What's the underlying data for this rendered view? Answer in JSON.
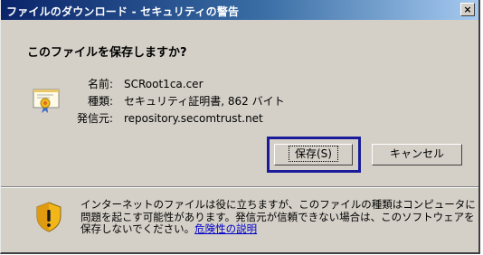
{
  "window": {
    "title": "ファイルのダウンロード - セキュリティの警告",
    "close_label": "×"
  },
  "prompt": {
    "heading": "このファイルを保存しますか?"
  },
  "file_info": {
    "labels": [
      "名前:",
      "種類:",
      "発信元:"
    ],
    "values": [
      "SCRoot1ca.cer",
      "セキュリティ証明書, 862 バイト",
      "repository.secomtrust.net"
    ]
  },
  "buttons": {
    "save": "保存(S)",
    "cancel": "キャンセル"
  },
  "warning": {
    "text": "インターネットのファイルは役に立ちますが、このファイルの種類はコンピュータに問題を起こす可能性があります。発信元が信頼できない場合は、このソフトウェアを保存しないでください。",
    "link": "危険性の説明"
  },
  "icons": {
    "certificate": "certificate-icon",
    "warning": "security-shield-icon"
  },
  "colors": {
    "titlebar_start": "#0a246a",
    "titlebar_end": "#a6caf0",
    "highlight_box": "#1a1a9a",
    "link": "#0000cc"
  }
}
